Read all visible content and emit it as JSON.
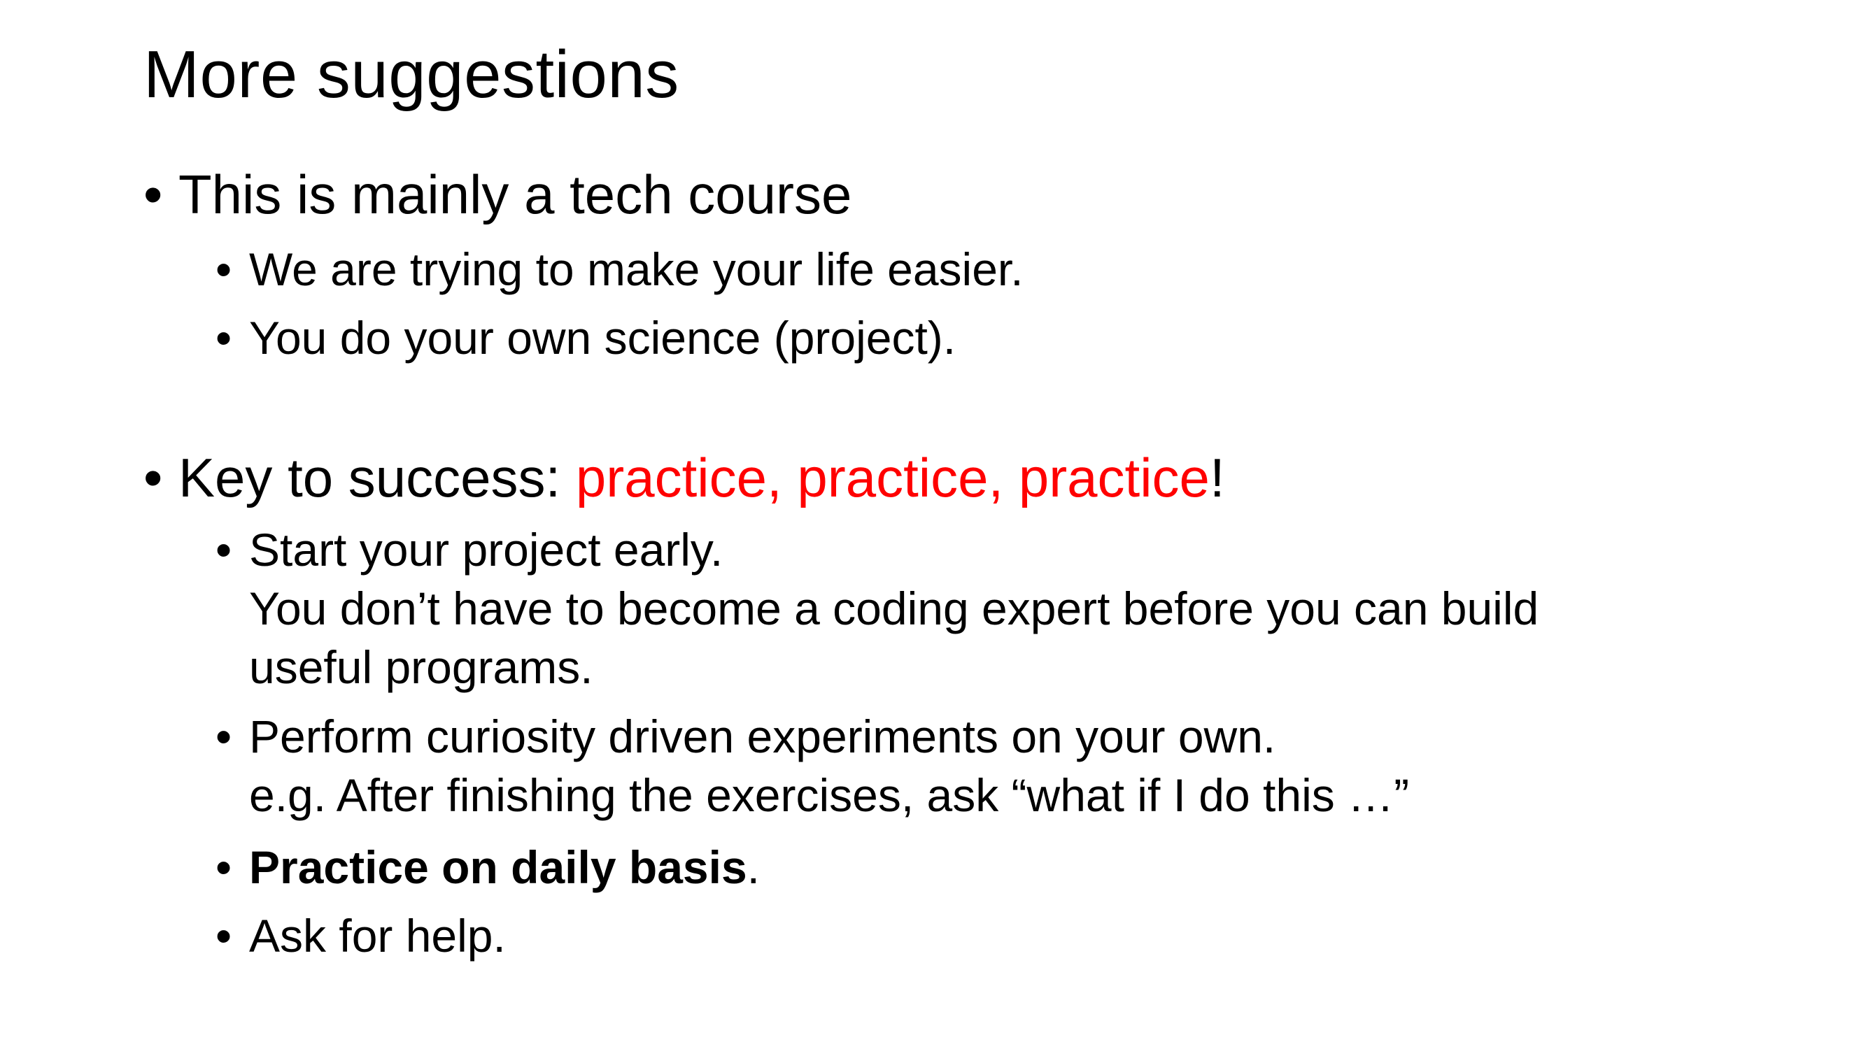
{
  "slide": {
    "title": "More suggestions",
    "bullet_char": "•",
    "sections": [
      {
        "heading": "This is mainly a tech course",
        "items": [
          {
            "line1": "We are trying to make your life easier."
          },
          {
            "line1": "You do your own science (project)."
          }
        ]
      },
      {
        "heading_prefix": "Key to success: ",
        "heading_highlight": "practice, practice, practice",
        "heading_suffix": "!",
        "items": [
          {
            "line1": "Start your project early.",
            "line2": "You don’t have to become a coding expert before you can build",
            "line3": "useful programs."
          },
          {
            "line1": "Perform curiosity driven experiments on your own.",
            "line2": "e.g. After finishing the exercises, ask “what if I do this …”"
          },
          {
            "bold": "Practice on daily basis",
            "suffix": "."
          },
          {
            "line1": "Ask for help."
          }
        ]
      }
    ],
    "colors": {
      "text": "#000000",
      "highlight": "#ff0000",
      "background": "#ffffff"
    }
  }
}
